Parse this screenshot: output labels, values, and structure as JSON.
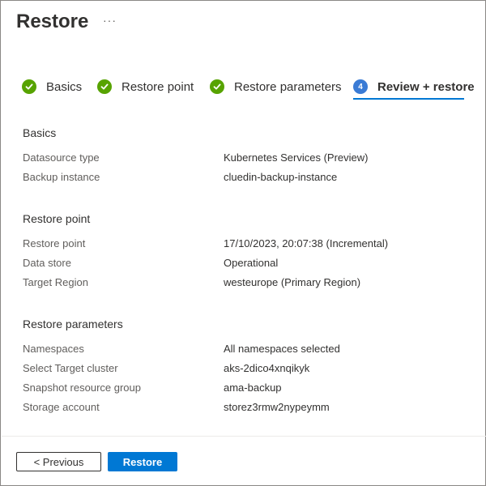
{
  "header": {
    "title": "Restore",
    "more_label": "···"
  },
  "steps": [
    {
      "label": "Basics",
      "state": "done"
    },
    {
      "label": "Restore point",
      "state": "done"
    },
    {
      "label": "Restore parameters",
      "state": "done"
    },
    {
      "label": "Review + restore",
      "state": "active",
      "number": "4"
    }
  ],
  "sections": {
    "basics": {
      "title": "Basics",
      "rows": [
        {
          "key": "Datasource type",
          "value": "Kubernetes Services (Preview)"
        },
        {
          "key": "Backup instance",
          "value": "cluedin-backup-instance"
        }
      ]
    },
    "restore_point": {
      "title": "Restore point",
      "rows": [
        {
          "key": "Restore point",
          "value": "17/10/2023, 20:07:38 (Incremental)"
        },
        {
          "key": "Data store",
          "value": "Operational"
        },
        {
          "key": "Target Region",
          "value": "westeurope (Primary Region)"
        }
      ]
    },
    "restore_parameters": {
      "title": "Restore parameters",
      "rows": [
        {
          "key": "Namespaces",
          "value": "All namespaces selected"
        },
        {
          "key": "Select Target cluster",
          "value": "aks-2dico4xnqikyk"
        },
        {
          "key": "Snapshot resource group",
          "value": "ama-backup"
        },
        {
          "key": "Storage account",
          "value": "storez3rmw2nypeymm"
        }
      ]
    }
  },
  "footer": {
    "previous_label": "< Previous",
    "restore_label": "Restore"
  },
  "colors": {
    "accent": "#0078d4",
    "success": "#57a300",
    "step_number": "#3a7bd5"
  }
}
